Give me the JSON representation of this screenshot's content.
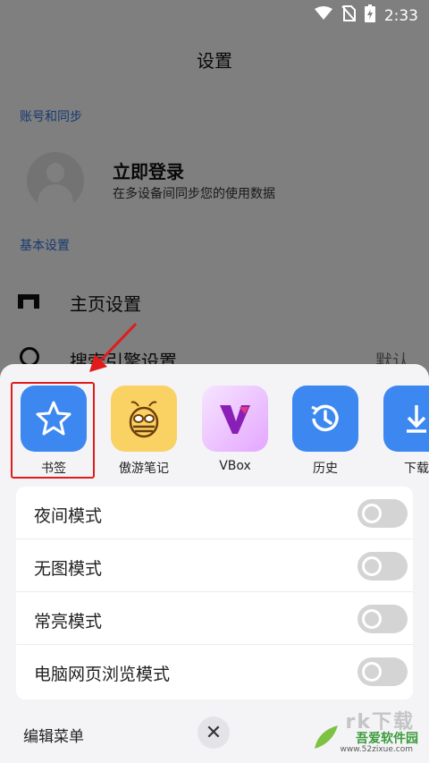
{
  "status_bar": {
    "time": "2:33"
  },
  "header": {
    "title": "设置"
  },
  "sections": {
    "account_label": "账号和同步",
    "basic_label": "基本设置"
  },
  "login": {
    "title": "立即登录",
    "subtitle": "在多设备间同步您的使用数据"
  },
  "settings_rows": {
    "home": "主页设置",
    "search": "搜索引擎设置",
    "search_value": "默认"
  },
  "apps": [
    {
      "label": "书签",
      "icon": "star-icon"
    },
    {
      "label": "傲游笔记",
      "icon": "bee-icon"
    },
    {
      "label": "VBox",
      "icon": "vbox-logo"
    },
    {
      "label": "历史",
      "icon": "history-icon"
    },
    {
      "label": "下载",
      "icon": "download-icon"
    }
  ],
  "toggles": [
    {
      "label": "夜间模式",
      "on": false
    },
    {
      "label": "无图模式",
      "on": false
    },
    {
      "label": "常亮模式",
      "on": false
    },
    {
      "label": "电脑网页浏览模式",
      "on": false
    }
  ],
  "bottom": {
    "edit_menu": "编辑菜单",
    "close_glyph": "✕"
  },
  "watermark": {
    "brand": "吾爱软件园",
    "url": "www.52zixue.com",
    "big": "rk下载"
  },
  "colors": {
    "accent": "#3d88f0",
    "link": "#2f74e0",
    "highlight": "#e11b1b"
  }
}
